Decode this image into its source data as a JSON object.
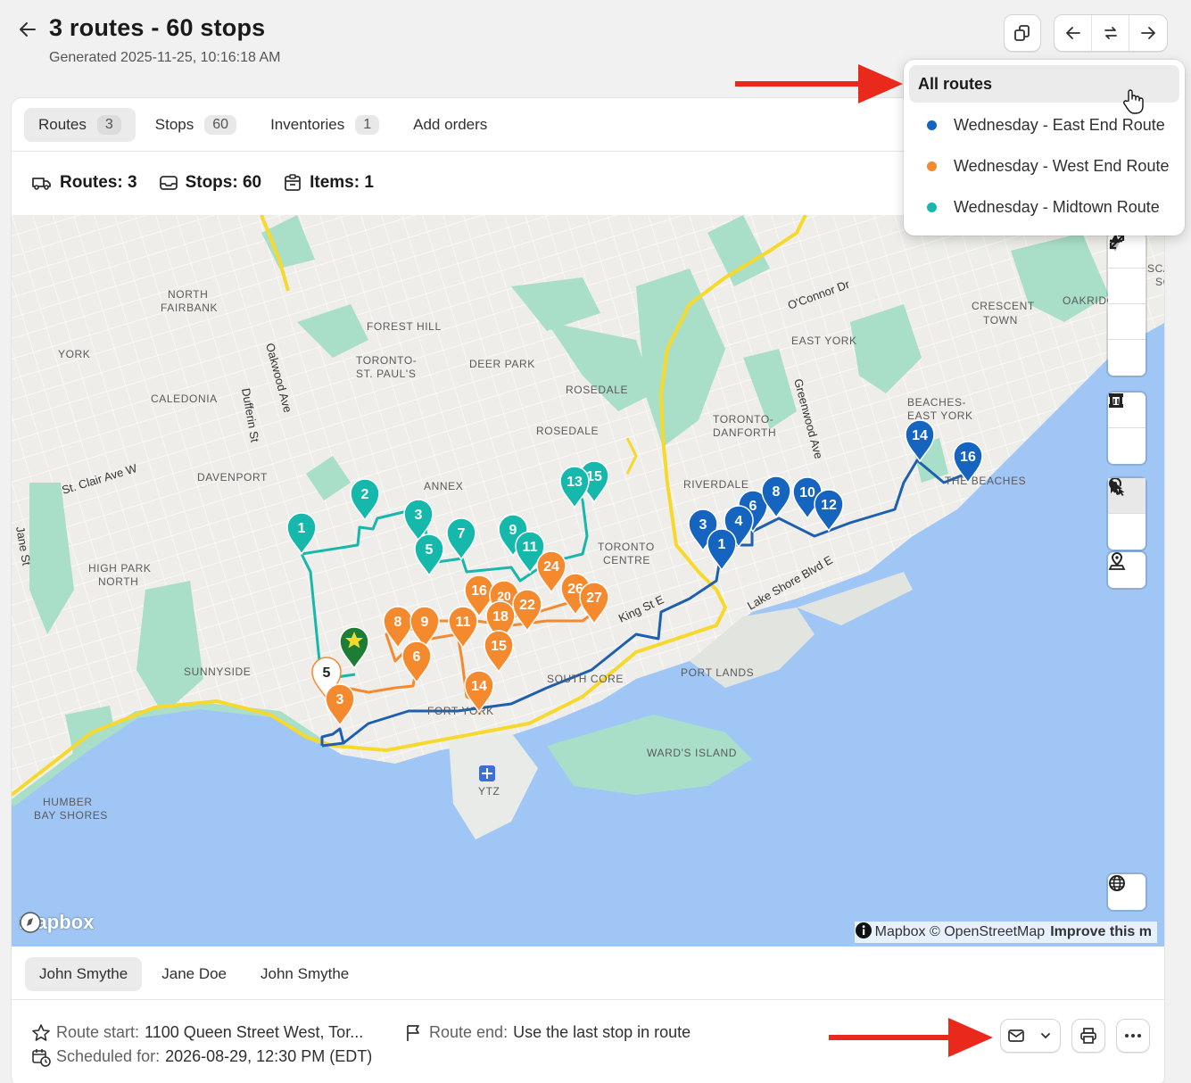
{
  "header": {
    "title": "3 routes - 60 stops",
    "subtitle": "Generated 2025-11-25, 10:16:18 AM"
  },
  "tabs": [
    {
      "label": "Routes",
      "count": "3"
    },
    {
      "label": "Stops",
      "count": "60"
    },
    {
      "label": "Inventories",
      "count": "1"
    },
    {
      "label": "Add orders",
      "count": ""
    }
  ],
  "summary": {
    "routes": "Routes: 3",
    "stops": "Stops: 60",
    "items": "Items: 1"
  },
  "dropdown": {
    "header": "All routes",
    "options": [
      {
        "label": "Wednesday - East End Route",
        "color": "#1565c0"
      },
      {
        "label": "Wednesday - West End Route",
        "color": "#f5892e"
      },
      {
        "label": "Wednesday - Midtown Route",
        "color": "#17b8ac"
      }
    ]
  },
  "map": {
    "labels": [
      {
        "text": "NORTH"
      },
      {
        "text": "FAIRBANK"
      },
      {
        "text": "YORK"
      },
      {
        "text": "CALEDONIA"
      },
      {
        "text": "FOREST HILL"
      },
      {
        "text": "TORONTO-"
      },
      {
        "text": "ST. PAUL'S"
      },
      {
        "text": "DEER PARK"
      },
      {
        "text": "ROSEDALE"
      },
      {
        "text": "ROSEDALE"
      },
      {
        "text": "DAVENPORT"
      },
      {
        "text": "ANNEX"
      },
      {
        "text": "HIGH PARK"
      },
      {
        "text": "NORTH"
      },
      {
        "text": "SUNNYSIDE"
      },
      {
        "text": "TORONTO"
      },
      {
        "text": "CENTRE"
      },
      {
        "text": "TORONTO-"
      },
      {
        "text": "DANFORTH"
      },
      {
        "text": "RIVERDALE"
      },
      {
        "text": "EAST YORK"
      },
      {
        "text": "CRESCENT"
      },
      {
        "text": "TOWN"
      },
      {
        "text": "OAKRIDGE"
      },
      {
        "text": "BEACHES-"
      },
      {
        "text": "EAST YORK"
      },
      {
        "text": "THE BEACHES"
      },
      {
        "text": "PORT LANDS"
      },
      {
        "text": "SOUTH CORE"
      },
      {
        "text": "WARD'S ISLAND"
      },
      {
        "text": "YTZ"
      },
      {
        "text": "HUMBER"
      },
      {
        "text": "BAY SHORES"
      },
      {
        "text": "FORT YORK"
      },
      {
        "text": "SCA"
      },
      {
        "text": "SC"
      }
    ],
    "streets": [
      {
        "text": "Oakwood Ave"
      },
      {
        "text": "Dufferin St"
      },
      {
        "text": "St. Clair Ave W"
      },
      {
        "text": "Jane St"
      },
      {
        "text": "O'Connor Dr"
      },
      {
        "text": "Greenwood Ave"
      },
      {
        "text": "King St E"
      },
      {
        "text": "Lake Shore Blvd E"
      }
    ],
    "pins": {
      "teal": [
        "1",
        "2",
        "3",
        "5",
        "7",
        "9",
        "11",
        "13",
        "15"
      ],
      "orange": [
        "3",
        "6",
        "8",
        "9",
        "11",
        "14",
        "15",
        "16",
        "18",
        "20",
        "22",
        "24",
        "26",
        "27"
      ],
      "blue": [
        "1",
        "3",
        "4",
        "6",
        "8",
        "10",
        "12",
        "14",
        "16"
      ],
      "white": "5"
    },
    "logo": "mapbox",
    "attribution": "© Mapbox © OpenStreetMap",
    "attribution_link": "Improve this m"
  },
  "drivers": [
    "John Smythe",
    "Jane Doe",
    "John Smythe"
  ],
  "route": {
    "start_label": "Route start:",
    "start_value": "1100 Queen Street West, Tor...",
    "scheduled_label": "Scheduled for:",
    "scheduled_value": "2026-08-29, 12:30 PM (EDT)",
    "end_label": "Route end:",
    "end_value": "Use the last stop in route"
  },
  "colors": {
    "east": "#1565c0",
    "west": "#f5892e",
    "midtown": "#17b8ac",
    "start": "#1e7d34",
    "arrow": "#e8291c",
    "water": "#9fc6f5",
    "park": "#a8dfc9",
    "highway": "#f6d92c"
  }
}
